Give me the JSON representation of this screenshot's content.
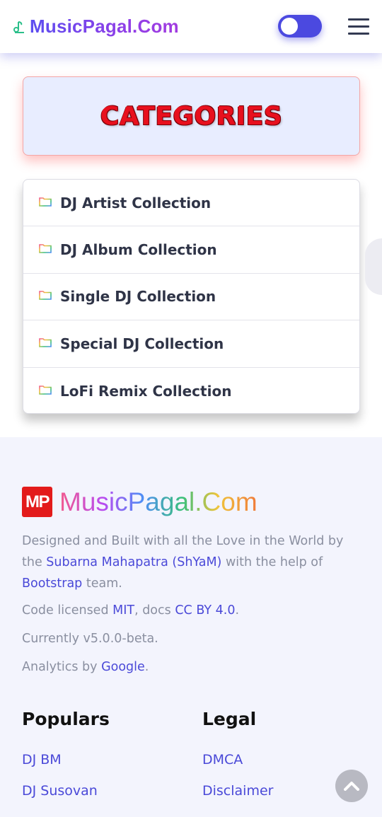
{
  "header": {
    "brand": "MusicPagal.Com"
  },
  "categories": {
    "title": "CATEGORIES",
    "items": [
      {
        "label": "DJ Artist Collection"
      },
      {
        "label": "DJ Album Collection"
      },
      {
        "label": "Single DJ Collection"
      },
      {
        "label": "Special DJ Collection"
      },
      {
        "label": "LoFi Remix Collection"
      }
    ]
  },
  "footer": {
    "logo_badge": "MP",
    "logo_text": "MusicPagal.Com",
    "credit": {
      "before": "Designed and Built with all the Love in the World by the ",
      "author_link": "Subarna Mahapatra (ShYaM)",
      "middle": " with the help of ",
      "bootstrap_link": "Bootstrap",
      "after": " team."
    },
    "license": {
      "before": "Code licensed ",
      "mit_link": "MIT",
      "middle": ", docs ",
      "cc_link": "CC BY 4.0",
      "after": "."
    },
    "version": "Currently v5.0.0-beta.",
    "analytics": {
      "before": "Analytics by ",
      "google_link": "Google",
      "after": "."
    },
    "populars": {
      "title": "Populars",
      "links": [
        "DJ BM",
        "DJ Susovan"
      ]
    },
    "legal": {
      "title": "Legal",
      "links": [
        "DMCA",
        "Disclaimer"
      ]
    }
  },
  "colors": {
    "accent": "#4b49e0",
    "categories_title": "#e8101e",
    "link": "#4a49d8",
    "logo_badge": "#e31b1b"
  },
  "icons": {
    "brand": "music-note-icon",
    "menu": "hamburger-menu-icon",
    "list_item": "folder-icon",
    "to_top": "chevron-up-icon"
  }
}
